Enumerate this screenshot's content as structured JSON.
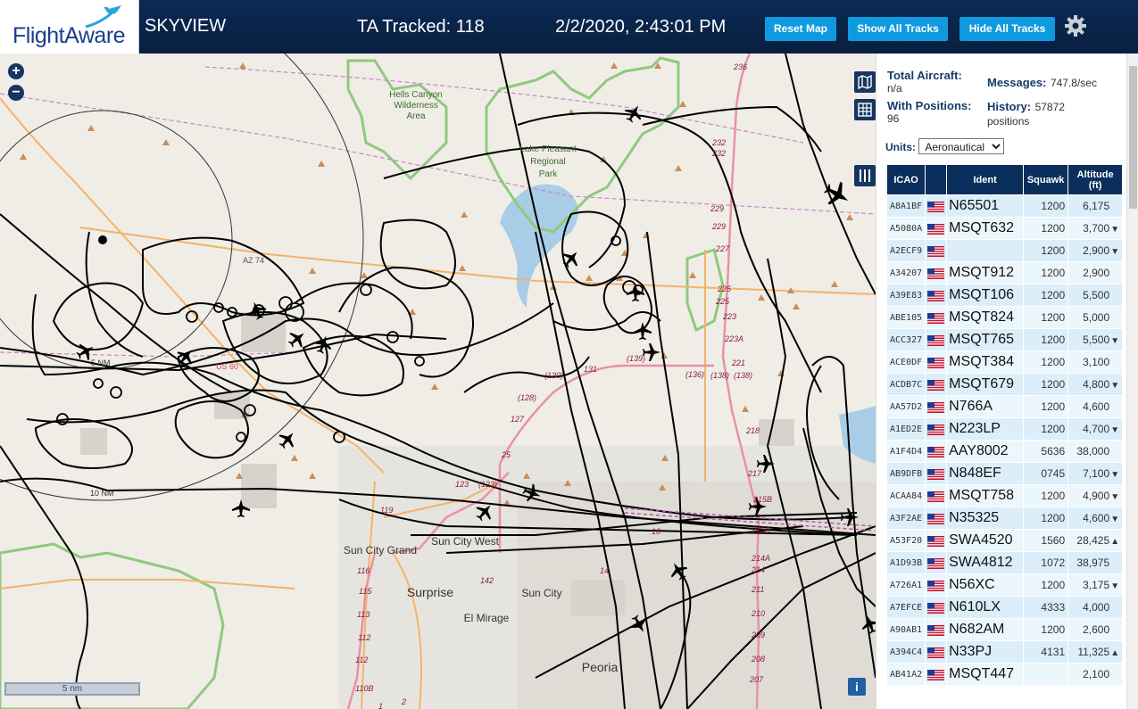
{
  "header": {
    "logo_text": "FlightAware",
    "app_title": "SKYVIEW",
    "tracked": "TA Tracked: 118",
    "datetime": "2/2/2020, 2:43:01 PM",
    "reset_map": "Reset Map",
    "show_all": "Show All Tracks",
    "hide_all": "Hide All Tracks",
    "gear_icon": "gear-icon"
  },
  "map": {
    "zoom_in": "+",
    "zoom_out": "−",
    "scale_label": "5 nm",
    "info": "i",
    "ring_labels": [
      "5 NM",
      "10 NM"
    ],
    "area_labels": [
      "Hells Canyon",
      "Wilderness",
      "Area",
      "Lake Pleasant",
      "Regional",
      "Park"
    ],
    "city_labels": [
      "Sun City West",
      "Sun City Grand",
      "Surprise",
      "Sun City",
      "El Mirage",
      "Peoria"
    ],
    "road_labels": [
      "AZ 74",
      "US 60"
    ],
    "route_numbers": [
      "236",
      "232",
      "232",
      "229",
      "229",
      "227",
      "225",
      "225",
      "223",
      "223A",
      "221",
      "(136)",
      "(138)",
      "(138)",
      "(130)",
      "131",
      "(128)",
      "127",
      "25",
      "123",
      "(123)",
      "119",
      "116",
      "115",
      "113",
      "112",
      "110B",
      "142",
      "14",
      "10",
      "215B",
      "215A",
      "214A",
      "214",
      "211",
      "210",
      "209",
      "208",
      "207",
      "218",
      "217",
      "(139)",
      "2",
      "1"
    ],
    "colors": {
      "land": "#f0ede6",
      "water": "#a9cde6",
      "park": "#7fc36b",
      "track": "#000000",
      "highway": "#e892a6",
      "road": "#f2b46a"
    }
  },
  "panel": {
    "total_aircraft_label": "Total Aircraft:",
    "total_aircraft_value": "n/a",
    "messages_label": "Messages:",
    "messages_value": "747.8/sec",
    "with_positions_label": "With Positions:",
    "with_positions_value": "96",
    "history_label": "History:",
    "history_value": "57872",
    "history_unit": "positions",
    "units_label": "Units:",
    "units_value": "Aeronautical",
    "table": {
      "headers": [
        "ICAO",
        "",
        "Ident",
        "Squawk",
        "Altitude (ft)"
      ],
      "rows": [
        {
          "icao": "A8A1BF",
          "ident": "N65501",
          "squawk": "1200",
          "alt": "6,175",
          "trend": ""
        },
        {
          "icao": "A5080A",
          "ident": "MSQT632",
          "squawk": "1200",
          "alt": "3,700",
          "trend": "▼"
        },
        {
          "icao": "A2ECF9",
          "ident": "",
          "squawk": "1200",
          "alt": "2,900",
          "trend": "▼"
        },
        {
          "icao": "A34207",
          "ident": "MSQT912",
          "squawk": "1200",
          "alt": "2,900",
          "trend": ""
        },
        {
          "icao": "A39E83",
          "ident": "MSQT106",
          "squawk": "1200",
          "alt": "5,500",
          "trend": ""
        },
        {
          "icao": "ABE105",
          "ident": "MSQT824",
          "squawk": "1200",
          "alt": "5,000",
          "trend": ""
        },
        {
          "icao": "ACC327",
          "ident": "MSQT765",
          "squawk": "1200",
          "alt": "5,500",
          "trend": "▼"
        },
        {
          "icao": "ACE0DF",
          "ident": "MSQT384",
          "squawk": "1200",
          "alt": "3,100",
          "trend": ""
        },
        {
          "icao": "ACDB7C",
          "ident": "MSQT679",
          "squawk": "1200",
          "alt": "4,800",
          "trend": "▼"
        },
        {
          "icao": "AA57D2",
          "ident": "N766A",
          "squawk": "1200",
          "alt": "4,600",
          "trend": ""
        },
        {
          "icao": "A1ED2E",
          "ident": "N223LP",
          "squawk": "1200",
          "alt": "4,700",
          "trend": "▼"
        },
        {
          "icao": "A1F4D4",
          "ident": "AAY8002",
          "squawk": "5636",
          "alt": "38,000",
          "trend": ""
        },
        {
          "icao": "AB9DFB",
          "ident": "N848EF",
          "squawk": "0745",
          "alt": "7,100",
          "trend": "▼"
        },
        {
          "icao": "ACAA84",
          "ident": "MSQT758",
          "squawk": "1200",
          "alt": "4,900",
          "trend": "▼"
        },
        {
          "icao": "A3F2AE",
          "ident": "N35325",
          "squawk": "1200",
          "alt": "4,600",
          "trend": "▼"
        },
        {
          "icao": "A53F20",
          "ident": "SWA4520",
          "squawk": "1560",
          "alt": "28,425",
          "trend": "▲"
        },
        {
          "icao": "A1D93B",
          "ident": "SWA4812",
          "squawk": "1072",
          "alt": "38,975",
          "trend": ""
        },
        {
          "icao": "A726A1",
          "ident": "N56XC",
          "squawk": "1200",
          "alt": "3,175",
          "trend": "▼"
        },
        {
          "icao": "A7EFCE",
          "ident": "N610LX",
          "squawk": "4333",
          "alt": "4,000",
          "trend": ""
        },
        {
          "icao": "A90AB1",
          "ident": "N682AM",
          "squawk": "1200",
          "alt": "2,600",
          "trend": ""
        },
        {
          "icao": "A394C4",
          "ident": "N33PJ",
          "squawk": "4131",
          "alt": "11,325",
          "trend": "▲"
        },
        {
          "icao": "AB41A2",
          "ident": "MSQT447",
          "squawk": "",
          "alt": "2,100",
          "trend": ""
        }
      ]
    }
  }
}
